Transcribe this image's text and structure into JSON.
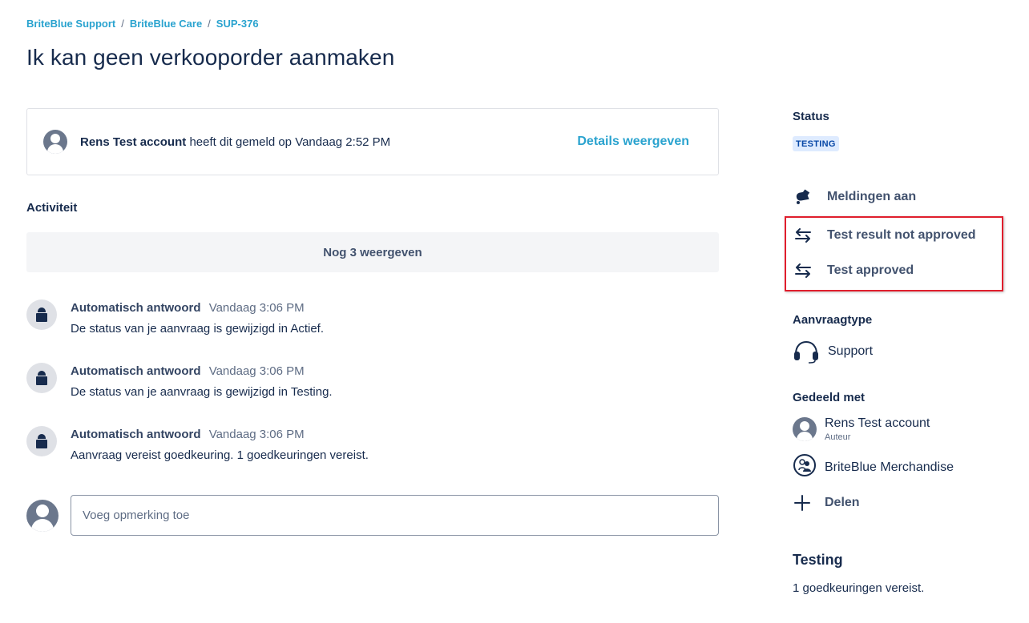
{
  "breadcrumb": {
    "items": [
      "BriteBlue Support",
      "BriteBlue Care",
      "SUP-376"
    ],
    "separator": "/"
  },
  "page_title": "Ik kan geen verkooporder aanmaken",
  "reporter": {
    "name": "Rens Test account",
    "text": "heeft dit gemeld op Vandaag 2:52 PM",
    "details_link": "Details weergeven"
  },
  "activity": {
    "title": "Activiteit",
    "show_more": "Nog 3 weergeven",
    "items": [
      {
        "author": "Automatisch antwoord",
        "time": "Vandaag 3:06 PM",
        "body": "De status van je aanvraag is gewijzigd in Actief."
      },
      {
        "author": "Automatisch antwoord",
        "time": "Vandaag 3:06 PM",
        "body": "De status van je aanvraag is gewijzigd in Testing."
      },
      {
        "author": "Automatisch antwoord",
        "time": "Vandaag 3:06 PM",
        "body": "Aanvraag vereist goedkeuring. 1 goedkeuringen vereist."
      }
    ]
  },
  "comment": {
    "placeholder": "Voeg opmerking toe"
  },
  "sidebar": {
    "status_label": "Status",
    "status_value": "TESTING",
    "notifications": "Meldingen aan",
    "transitions": [
      "Test result not approved",
      "Test approved"
    ],
    "request_type_label": "Aanvraagtype",
    "request_type_value": "Support",
    "shared_label": "Gedeeld met",
    "shared": [
      {
        "name": "Rens Test account",
        "role": "Auteur"
      },
      {
        "name": "BriteBlue Merchandise"
      }
    ],
    "share_button": "Delen",
    "approval_title": "Testing",
    "approval_desc": "1 goedkeuringen vereist."
  },
  "colors": {
    "link": "#2aa3cf",
    "highlight": "#e01e2d",
    "lozenge_bg": "#deebff",
    "lozenge_text": "#0747a6"
  }
}
